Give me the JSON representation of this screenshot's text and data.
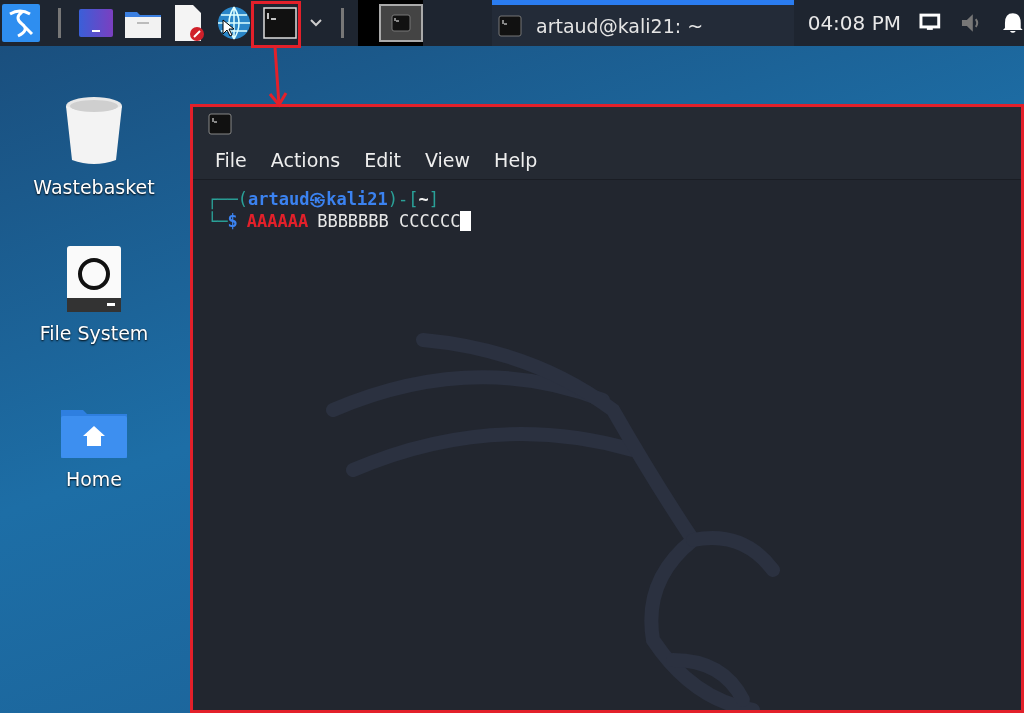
{
  "taskbar": {
    "window_button": {
      "title": "artaud@kali21: ~",
      "selected": true
    },
    "clock": "04:08 PM"
  },
  "desktop_icons": [
    {
      "label": "Wastebasket",
      "kind": "trash"
    },
    {
      "label": "File System",
      "kind": "drive"
    },
    {
      "label": "Home",
      "kind": "home"
    }
  ],
  "terminal": {
    "menu": [
      "File",
      "Actions",
      "Edit",
      "View",
      "Help"
    ],
    "prompt": {
      "open": "┌──(",
      "user_host": "artaud㉿kali21",
      "middle": ")-[",
      "cwd": "~",
      "close": "]",
      "corner": "└─",
      "symbol": "$"
    },
    "command": [
      {
        "text": "AAAAAA",
        "kind": "error"
      },
      {
        "text": "BBBBBBB CCCCCC",
        "kind": "plain"
      }
    ]
  }
}
